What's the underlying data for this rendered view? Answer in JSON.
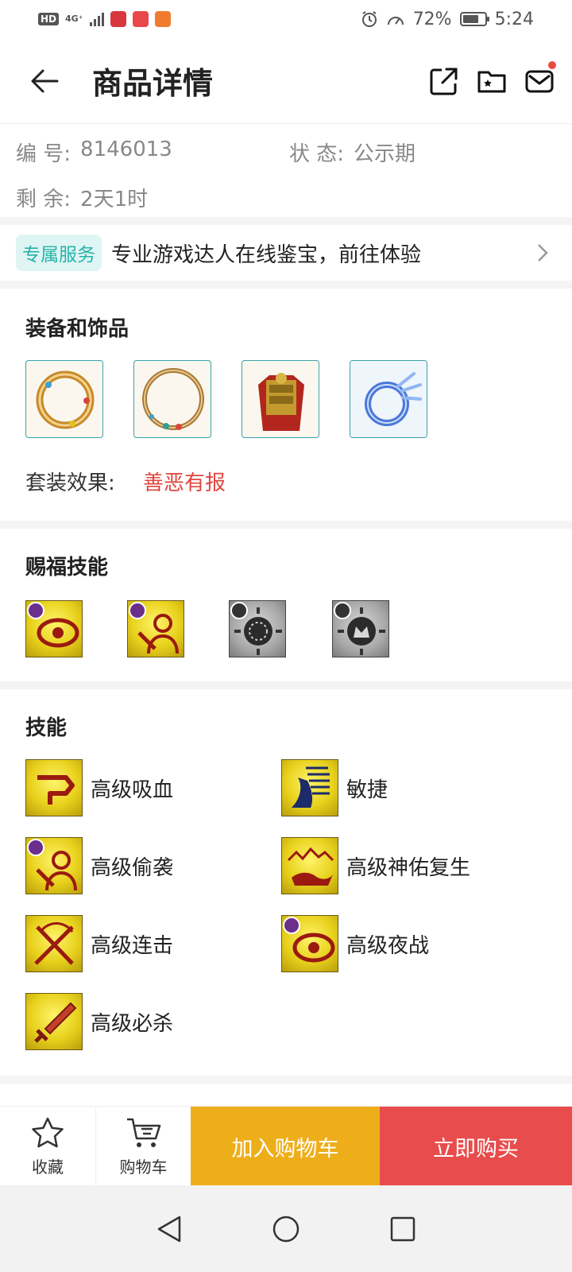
{
  "status": {
    "hd": "HD",
    "network": "4G⁺",
    "battery_pct": "72%",
    "time": "5:24",
    "battery_level": 0.72
  },
  "header": {
    "title": "商品详情"
  },
  "info": {
    "id_label": "编 号:",
    "id_value": "8146013",
    "status_label": "状 态:",
    "status_value": "公示期",
    "remaining_label": "剩 余:",
    "remaining_value": "2天1时"
  },
  "service": {
    "tag": "专属服务",
    "text": "专业游戏达人在线鉴宝，前往体验"
  },
  "equipment": {
    "title": "装备和饰品",
    "items": [
      "jade-ring-icon",
      "bronze-ring-icon",
      "red-armor-icon",
      "crystal-wing-ring-icon"
    ],
    "suit_label": "套装效果:",
    "suit_value": "善恶有报"
  },
  "blessing": {
    "title": "赐福技能",
    "icons": [
      "night-eye-skill-icon",
      "sneak-attack-skill-icon",
      "grey-rune-skill-icon",
      "grey-crown-skill-icon"
    ]
  },
  "skills": {
    "title": "技能",
    "items": [
      {
        "name": "高级吸血",
        "icon": "blood-drain-icon"
      },
      {
        "name": "敏捷",
        "icon": "agility-icon"
      },
      {
        "name": "高级偷袭",
        "icon": "sneak-attack-icon"
      },
      {
        "name": "高级神佑复生",
        "icon": "divine-revive-icon"
      },
      {
        "name": "高级连击",
        "icon": "combo-attack-icon"
      },
      {
        "name": "高级夜战",
        "icon": "night-battle-icon"
      },
      {
        "name": "高级必杀",
        "icon": "critical-strike-icon"
      }
    ]
  },
  "bottom_bar": {
    "favorite": "收藏",
    "cart": "购物车",
    "add_to_cart": "加入购物车",
    "buy_now": "立即购买"
  },
  "colors": {
    "accent_teal": "#27b3a8",
    "suit_red": "#e0453f",
    "cart_button": "#eeae1a",
    "buy_button": "#e84c4c"
  }
}
